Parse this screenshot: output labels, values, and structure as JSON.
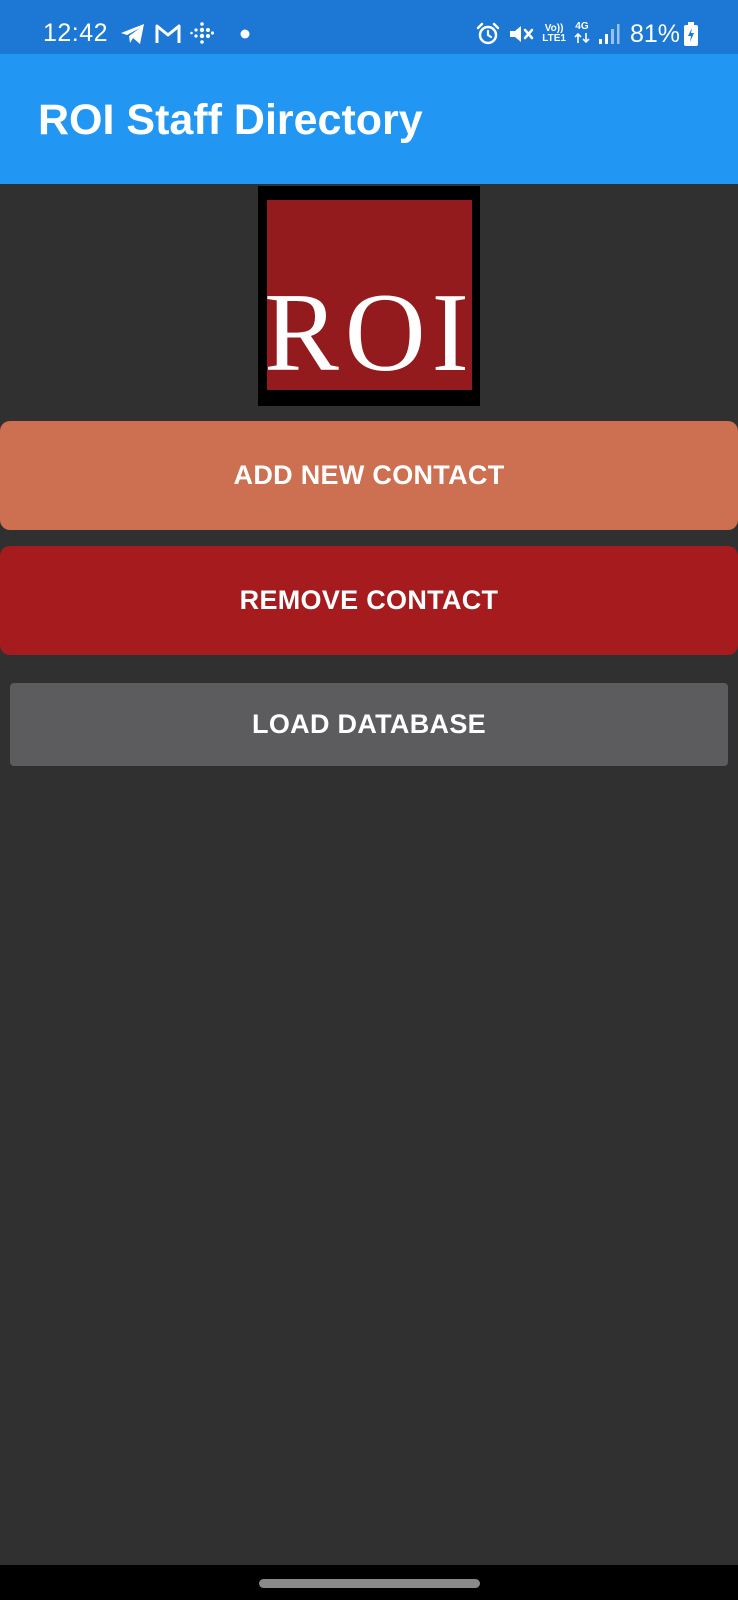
{
  "status_bar": {
    "time": "12:42",
    "left_icons": [
      "telegram-icon",
      "gmail-icon",
      "fitbit-icon",
      "notification-dot-icon"
    ],
    "right_icons": [
      "alarm-icon",
      "mute-icon",
      "volte-icon",
      "4g-data-icon",
      "signal-icon"
    ],
    "volte_label_top": "Vo))",
    "volte_label_bottom": "LTE1",
    "network_label": "4G",
    "battery_percent": "81%"
  },
  "app_bar": {
    "title": "ROI Staff Directory"
  },
  "logo": {
    "text": "ROI",
    "background_color": "#931a1d"
  },
  "buttons": {
    "add_contact": "ADD NEW CONTACT",
    "remove_contact": "REMOVE CONTACT",
    "load_database": "LOAD DATABASE"
  },
  "colors": {
    "status_bar": "#1c78d4",
    "app_bar": "#2196f3",
    "background": "#303030",
    "add_button": "#cd6f51",
    "remove_button": "#a51b1e",
    "load_button": "#5c5c5e"
  }
}
